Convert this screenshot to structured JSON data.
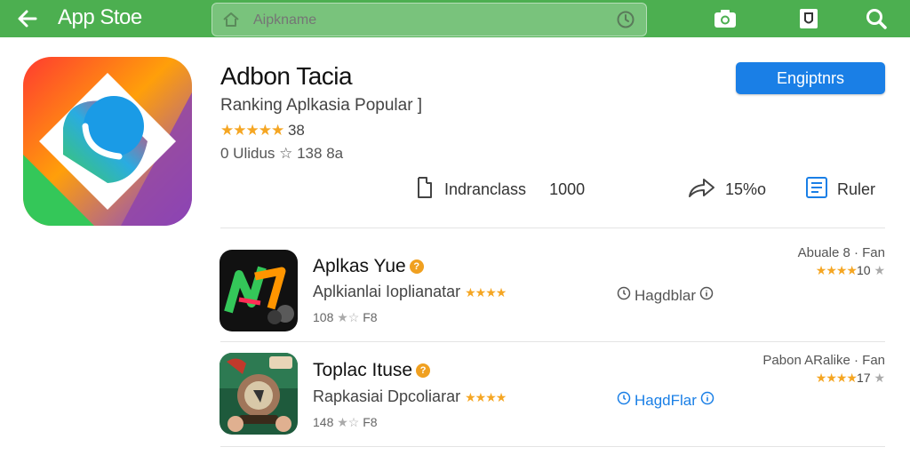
{
  "appbar": {
    "title": "App Stoe",
    "search_placeholder": "Aipkname",
    "icons": [
      "back-arrow-icon",
      "home-icon",
      "clock-icon",
      "camera-icon",
      "shield-icon",
      "search-icon"
    ]
  },
  "hero": {
    "name": "Adbon Tacia",
    "subtitle": "Ranking Aplkasia Popular ]",
    "stars": "★★★★★",
    "rating": "38",
    "meta": "0 Ulidus ☆ 138 8a",
    "install_label": "Engiptnrs",
    "actions": [
      {
        "icon": "bookmark-icon",
        "label": "Indranclass",
        "value": "1000"
      },
      {
        "icon": "share-icon",
        "label": "15%o",
        "value": ""
      },
      {
        "icon": "list-icon",
        "label": "Ruler",
        "value": ""
      }
    ]
  },
  "list": [
    {
      "title": "Aplkas Yue",
      "desc": "Aplkianlai Ioplianatar",
      "desc_stars": "★★★★",
      "meta": "108 ",
      "meta_grey": "★☆ ",
      "meta_tail": "F8",
      "mid": "Hagdblar",
      "mid_color": "#555555",
      "right_top": "Abuale 8 · Fan",
      "right_stars": "★★★★",
      "right_value": "10",
      "right_grey": "★"
    },
    {
      "title": "Toplac Ituse",
      "desc": "Rapkasiai Dpcoliarar",
      "desc_stars": "★★★★",
      "meta": "148 ",
      "meta_grey": "★☆ ",
      "meta_tail": "F8",
      "mid": "HagdFlar",
      "mid_color": "#1a7fe6",
      "right_top": "Pabon ARalike · Fan",
      "right_stars": "★★★★",
      "right_value": "17",
      "right_grey": "★"
    }
  ],
  "colors": {
    "appbar": "#4caf50",
    "accent": "#1a7fe6",
    "star": "#f5a623"
  }
}
